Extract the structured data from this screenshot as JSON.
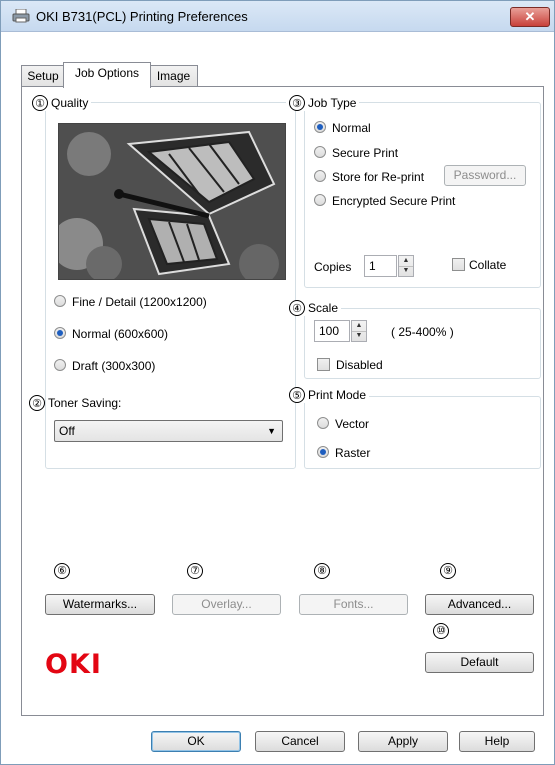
{
  "window": {
    "title": "OKI B731(PCL) Printing Preferences",
    "close_label": "✕"
  },
  "tabs": [
    {
      "label": "Setup",
      "active": false
    },
    {
      "label": "Job Options",
      "active": true
    },
    {
      "label": "Image",
      "active": false
    }
  ],
  "quality": {
    "number": "①",
    "title": "Quality",
    "options": [
      {
        "label": "Fine / Detail (1200x1200)",
        "checked": false
      },
      {
        "label": "Normal (600x600)",
        "checked": true
      },
      {
        "label": "Draft (300x300)",
        "checked": false
      }
    ]
  },
  "toner": {
    "number": "②",
    "title": "Toner Saving:",
    "value": "Off"
  },
  "job_type": {
    "number": "③",
    "title": "Job Type",
    "options": [
      {
        "label": "Normal",
        "checked": true
      },
      {
        "label": "Secure Print",
        "checked": false
      },
      {
        "label": "Store for Re-print",
        "checked": false
      },
      {
        "label": "Encrypted Secure Print",
        "checked": false
      }
    ],
    "password_button": "Password...",
    "copies_label": "Copies",
    "copies_value": "1",
    "collate_label": "Collate"
  },
  "scale": {
    "number": "④",
    "title": "Scale",
    "value": "100",
    "range": "( 25-400% )",
    "disabled_label": "Disabled"
  },
  "print_mode": {
    "number": "⑤",
    "title": "Print Mode",
    "options": [
      {
        "label": "Vector",
        "checked": false
      },
      {
        "label": "Raster",
        "checked": true
      }
    ]
  },
  "bottom_buttons": [
    {
      "number": "⑥",
      "label": "Watermarks...",
      "enabled": true
    },
    {
      "number": "⑦",
      "label": "Overlay...",
      "enabled": false
    },
    {
      "number": "⑧",
      "label": "Fonts...",
      "enabled": false
    },
    {
      "number": "⑨",
      "label": "Advanced...",
      "enabled": true
    }
  ],
  "default_button": {
    "number": "⑩",
    "label": "Default"
  },
  "brand": {
    "logo_text": "OKI",
    "color": "#e30613"
  },
  "dialog_buttons": {
    "ok": "OK",
    "cancel": "Cancel",
    "apply": "Apply",
    "help": "Help"
  }
}
